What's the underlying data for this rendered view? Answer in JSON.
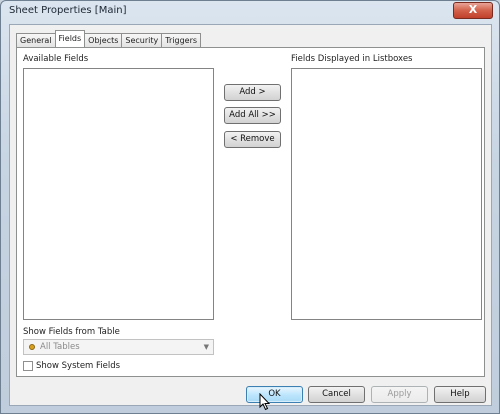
{
  "window": {
    "title": "Sheet Properties [Main]",
    "close_label": "X"
  },
  "tabs": [
    {
      "label": "General"
    },
    {
      "label": "Fields",
      "active": true
    },
    {
      "label": "Objects"
    },
    {
      "label": "Security"
    },
    {
      "label": "Triggers"
    }
  ],
  "fields_tab": {
    "available_label": "Available Fields",
    "displayed_label": "Fields Displayed in Listboxes",
    "add_label": "Add >",
    "add_all_label": "Add All >>",
    "remove_label": "< Remove",
    "show_from_table_label": "Show Fields from Table",
    "table_select_value": "All Tables",
    "show_system_label": "Show System Fields",
    "show_system_checked": false
  },
  "footer": {
    "ok_label": "OK",
    "cancel_label": "Cancel",
    "apply_label": "Apply",
    "help_label": "Help"
  },
  "icons": {
    "close": "close-icon",
    "table_dot": "table-dot-icon",
    "dropdown": "chevron-down-icon",
    "cursor": "mouse-pointer-icon"
  },
  "colors": {
    "title_bar": "#c7d4e2",
    "close_button": "#c0412b",
    "client_bg": "#f0f0f0",
    "table_dot": "#d8a020"
  }
}
